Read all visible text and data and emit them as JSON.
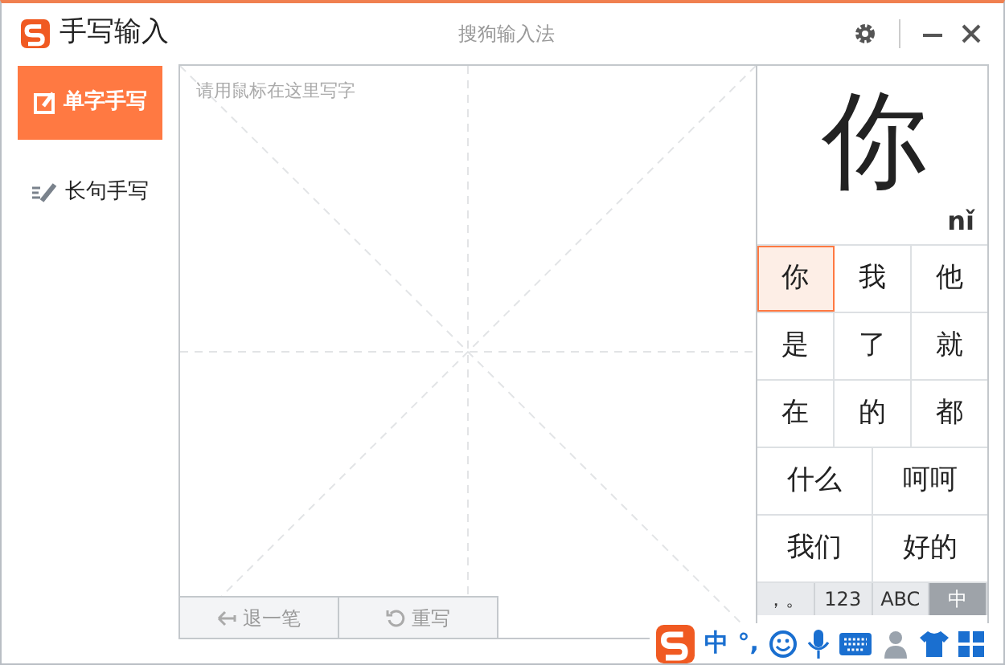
{
  "window": {
    "title": "手写输入",
    "subtitle": "搜狗输入法"
  },
  "sidebar": {
    "items": [
      {
        "label": "单字手写",
        "kind": "single",
        "selected": true
      },
      {
        "label": "长句手写",
        "kind": "sentence",
        "selected": false
      }
    ]
  },
  "canvas": {
    "placeholder": "请用鼠标在这里写字",
    "buttons": [
      {
        "label": "退一笔",
        "kind": "undo"
      },
      {
        "label": "重写",
        "kind": "redo"
      }
    ]
  },
  "preview": {
    "character": "你",
    "pinyin": "nǐ"
  },
  "candidates": [
    [
      {
        "text": "你",
        "selected": true
      },
      {
        "text": "我",
        "selected": false
      },
      {
        "text": "他",
        "selected": false
      }
    ],
    [
      {
        "text": "是",
        "selected": false
      },
      {
        "text": "了",
        "selected": false
      },
      {
        "text": "就",
        "selected": false
      }
    ],
    [
      {
        "text": "在",
        "selected": false
      },
      {
        "text": "的",
        "selected": false
      },
      {
        "text": "都",
        "selected": false
      }
    ],
    [
      {
        "text": "什么",
        "selected": false
      },
      {
        "text": "呵呵",
        "selected": false
      }
    ],
    [
      {
        "text": "我们",
        "selected": false
      },
      {
        "text": "好的",
        "selected": false
      }
    ]
  ],
  "modes": [
    {
      "label": "，。",
      "selected": false
    },
    {
      "label": "123",
      "selected": false
    },
    {
      "label": "ABC",
      "selected": false
    },
    {
      "label": "中",
      "selected": true
    }
  ],
  "ime_bar": {
    "mode": "中",
    "punct": "°,"
  }
}
